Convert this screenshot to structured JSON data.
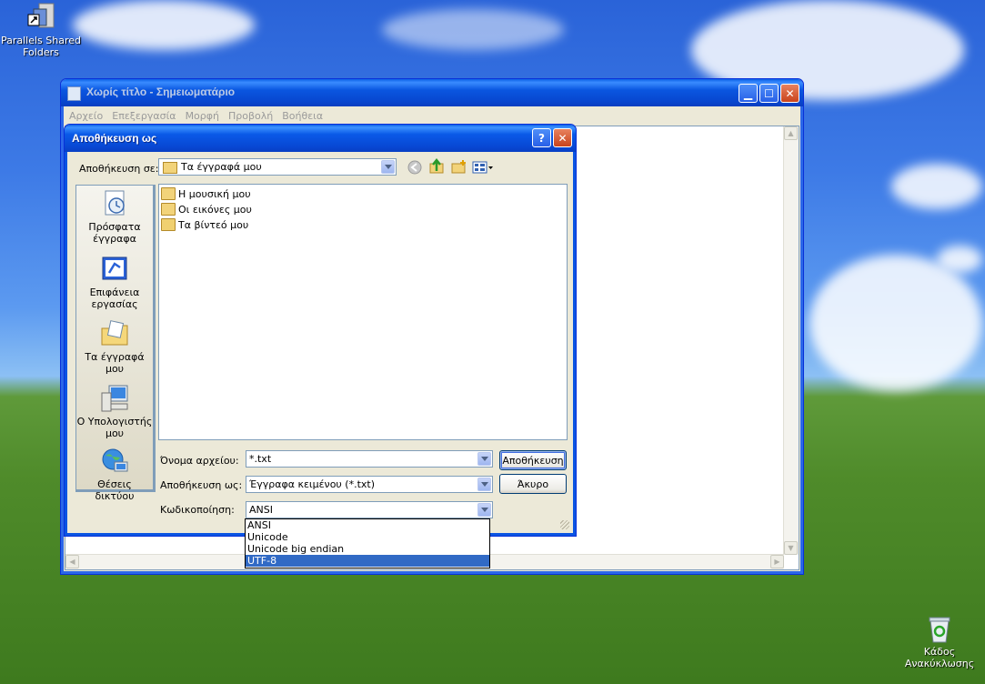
{
  "desktop": {
    "shared_folders_label": "Parallels Shared Folders",
    "recycle_bin_label": "Κάδος Ανακύκλωσης"
  },
  "notepad": {
    "title": "Χωρίς τίτλο - Σημειωματάριο",
    "menu": [
      "Αρχείο",
      "Επεξεργασία",
      "Μορφή",
      "Προβολή",
      "Βοήθεια"
    ]
  },
  "dialog": {
    "title": "Αποθήκευση ως",
    "save_in_label": "Αποθήκευση σε:",
    "save_in_value": "Τα έγγραφά μου",
    "places": [
      {
        "label": "Πρόσφατα έγγραφα",
        "icon": "recent-documents-icon"
      },
      {
        "label": "Επιφάνεια εργασίας",
        "icon": "desktop-icon"
      },
      {
        "label": "Τα έγγραφά μου",
        "icon": "my-documents-icon"
      },
      {
        "label": "Ο Υπολογιστής μου",
        "icon": "my-computer-icon"
      },
      {
        "label": "Θέσεις δικτύου",
        "icon": "network-places-icon"
      }
    ],
    "files": [
      "Η μουσική μου",
      "Οι εικόνες μου",
      "Τα βίντεό μου"
    ],
    "filename_label": "Όνομα αρχείου:",
    "filename_value": "*.txt",
    "savetype_label": "Αποθήκευση ως:",
    "savetype_value": "Έγγραφα κειμένου (*.txt)",
    "encoding_label": "Κωδικοποίηση:",
    "encoding_value": "ANSI",
    "encoding_options": [
      "ANSI",
      "Unicode",
      "Unicode big endian",
      "UTF-8"
    ],
    "encoding_highlighted": "UTF-8",
    "save_button": "Αποθήκευση",
    "cancel_button": "Άκυρο",
    "help_glyph": "?",
    "close_glyph": "✕"
  },
  "colors": {
    "title_blue": "#0a54e2",
    "selection": "#316ac5",
    "dialog_face": "#ece9d8"
  }
}
